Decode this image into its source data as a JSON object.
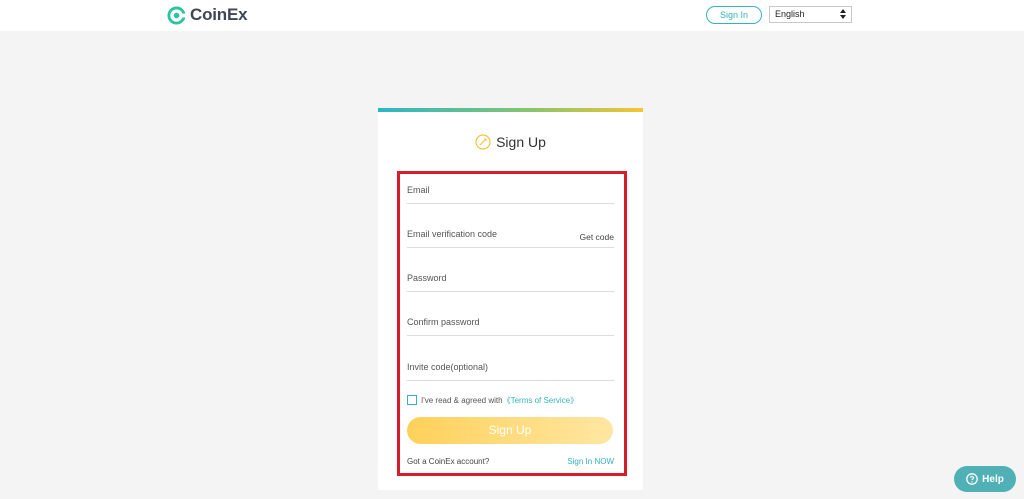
{
  "header": {
    "logo_text": "CoinEx",
    "signin_label": "Sign In",
    "language": "English"
  },
  "form": {
    "title": "Sign Up",
    "email_placeholder": "Email",
    "code_placeholder": "Email verification code",
    "get_code_label": "Get code",
    "password_placeholder": "Password",
    "confirm_password_placeholder": "Confirm password",
    "invite_placeholder": "Invite code(optional)",
    "agree_text": "I've read & agreed with",
    "terms_label": "《Terms of Service》",
    "signup_label": "Sign Up",
    "got_account": "Got a CoinEx account?",
    "signin_now": "Sign In NOW"
  },
  "help": {
    "label": "Help"
  },
  "colors": {
    "brand_teal": "#37b2bd",
    "button_yellow": "#ffd15a",
    "highlight_red": "#d81e2a",
    "help_bg": "#4fb0b6"
  },
  "icons": {
    "logo": "coinex-logo-icon",
    "title": "sign-up-icon",
    "select": "select-arrows-icon",
    "help": "help-question-icon"
  }
}
